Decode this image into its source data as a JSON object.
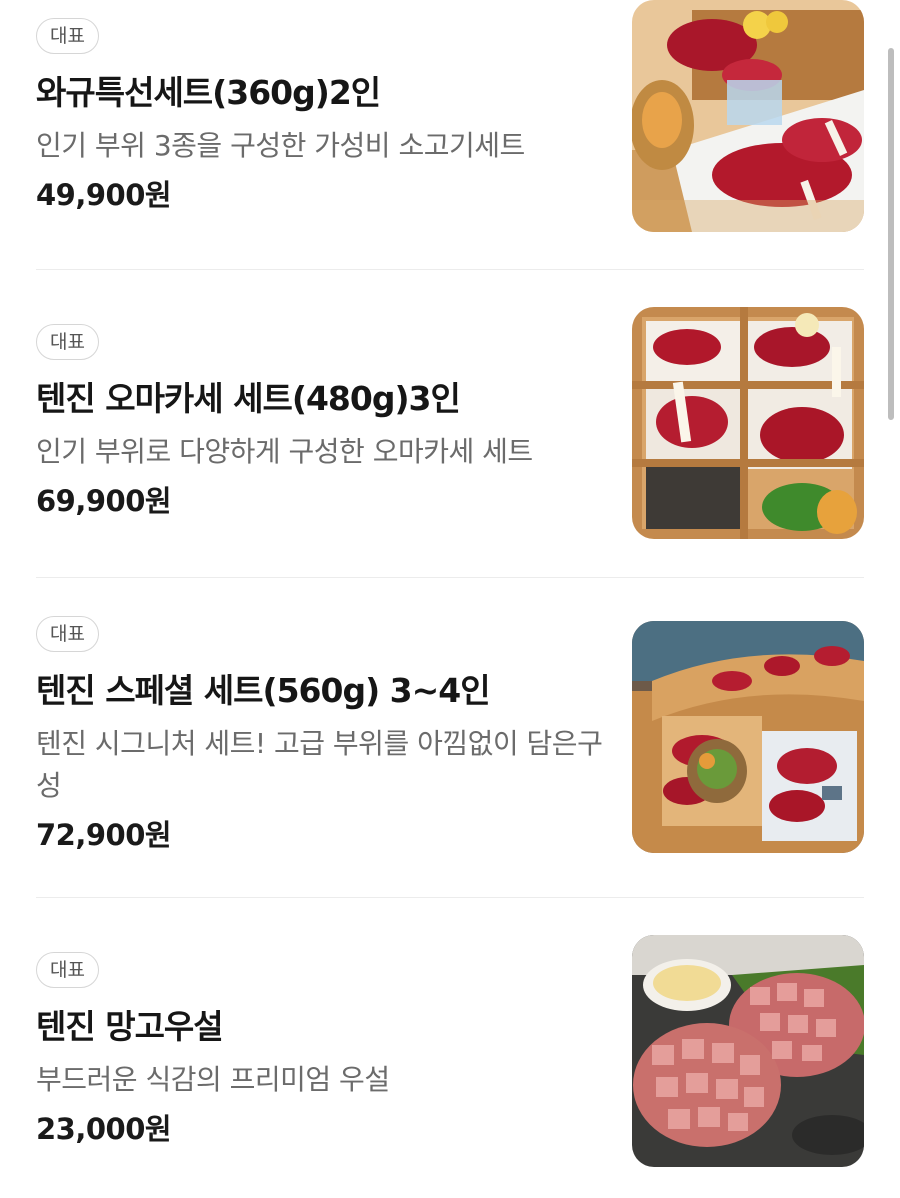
{
  "menu": {
    "items": [
      {
        "badge": "대표",
        "name": "와규특선세트(360g)2인",
        "description": "인기 부위 3종을 구성한 가성비 소고기세트",
        "price": "49,900원",
        "image_icon": "wagyu-platter-photo"
      },
      {
        "badge": "대표",
        "name": "텐진 오마카세 세트(480g)3인",
        "description": "인기 부위로 다양하게 구성한 오마카세 세트",
        "price": "69,900원",
        "image_icon": "omakase-box-photo"
      },
      {
        "badge": "대표",
        "name": "텐진 스페셜 세트(560g) 3~4인",
        "description": "텐진 시그니처 세트! 고급 부위를 아낌없이 담은구성",
        "price": "72,900원",
        "image_icon": "special-tray-photo"
      },
      {
        "badge": "대표",
        "name": "텐진 망고우설",
        "description": "부드러운 식감의 프리미엄 우설",
        "price": "23,000원",
        "image_icon": "mango-tongue-photo"
      }
    ]
  },
  "colors": {
    "badge_border": "#d6d6d6",
    "divider": "#ececec",
    "description_text": "#6b6b6b",
    "scrollbar": "#bdbdbd"
  }
}
